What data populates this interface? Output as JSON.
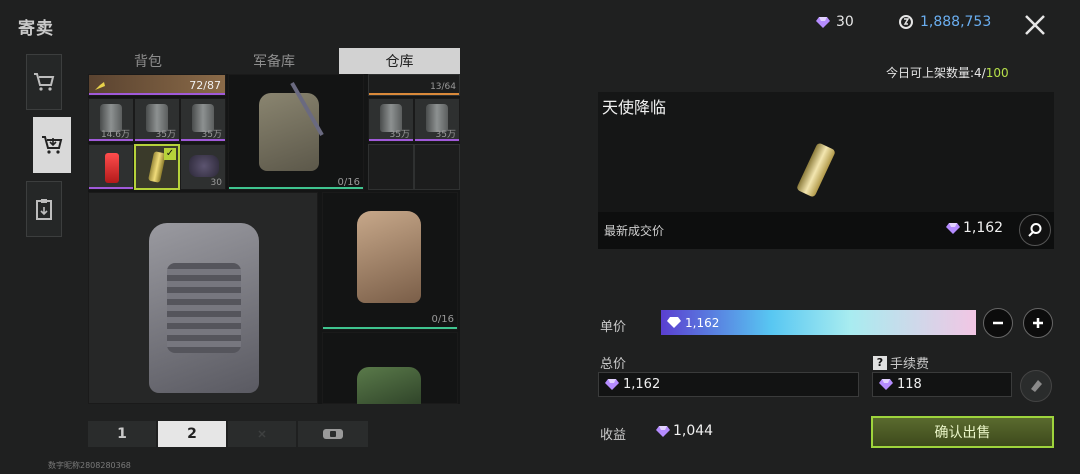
{
  "header": {
    "title": "寄卖",
    "diamonds": "30",
    "coins": "1,888,753",
    "close_icon": "close-icon"
  },
  "side_tabs": [
    {
      "icon": "cart-icon",
      "active": false
    },
    {
      "icon": "cart-sell-icon",
      "active": true
    },
    {
      "icon": "clipboard-icon",
      "active": false
    }
  ],
  "inventory": {
    "tabs": [
      "背包",
      "军备库",
      "仓库"
    ],
    "active_tab": 2,
    "slots": {
      "top_left_count": "72/87",
      "price_1": "14.6万",
      "price_2": "35万",
      "price_3": "35万",
      "stack_30": "30",
      "sling_bag_capacity": "0/16",
      "right_capacity": "13/64",
      "price_4": "35万",
      "price_5": "35万",
      "backpack_capacity": "0/16"
    },
    "pages": [
      "1",
      "2"
    ],
    "active_page": 1
  },
  "footer": {
    "digital_id": "数字昵称2808280368"
  },
  "listing": {
    "daily_label": "今日可上架数量:",
    "daily_used": "4",
    "daily_sep": "/",
    "daily_max": "100",
    "item_name": "天使降临",
    "latest_price_label": "最新成交价",
    "latest_price": "1,162",
    "unit_price_label": "单价",
    "unit_price": "1,162",
    "total_label": "总价",
    "total": "1,162",
    "fee_label": "手续费",
    "fee": "118",
    "income_label": "收益",
    "income": "1,044",
    "confirm_label": "确认出售"
  },
  "colors": {
    "accent_green": "#9ed43c",
    "coin_blue": "#6aaef0",
    "purple_rarity": "#a05ad9",
    "green_capacity": "#3fc48f"
  }
}
